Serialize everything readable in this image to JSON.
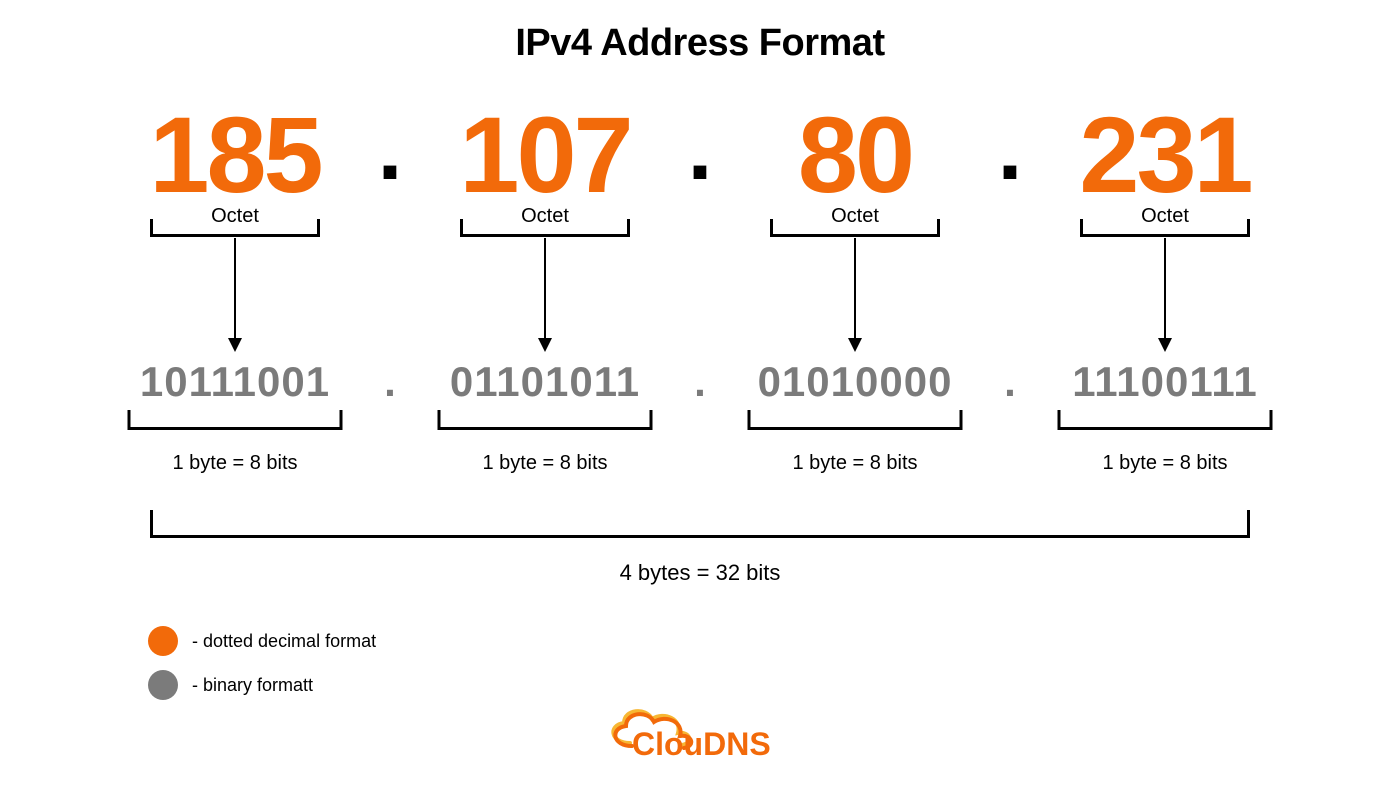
{
  "title": "IPv4 Address Format",
  "octets": [
    {
      "decimal": "185",
      "binary": "10111001",
      "octet_label": "Octet",
      "byte_label": "1 byte = 8 bits"
    },
    {
      "decimal": "107",
      "binary": "01101011",
      "octet_label": "Octet",
      "byte_label": "1 byte = 8 bits"
    },
    {
      "decimal": "80",
      "binary": "01010000",
      "octet_label": "Octet",
      "byte_label": "1 byte = 8 bits"
    },
    {
      "decimal": "231",
      "binary": "11100111",
      "octet_label": "Octet",
      "byte_label": "1 byte = 8 bits"
    }
  ],
  "separator": ".",
  "total_label": "4 bytes = 32 bits",
  "legend": {
    "decimal": "- dotted decimal format",
    "binary": "- binary formatt"
  },
  "colors": {
    "orange": "#f26a0a",
    "gray": "#7b7b7b"
  },
  "brand": "ClouDNS"
}
